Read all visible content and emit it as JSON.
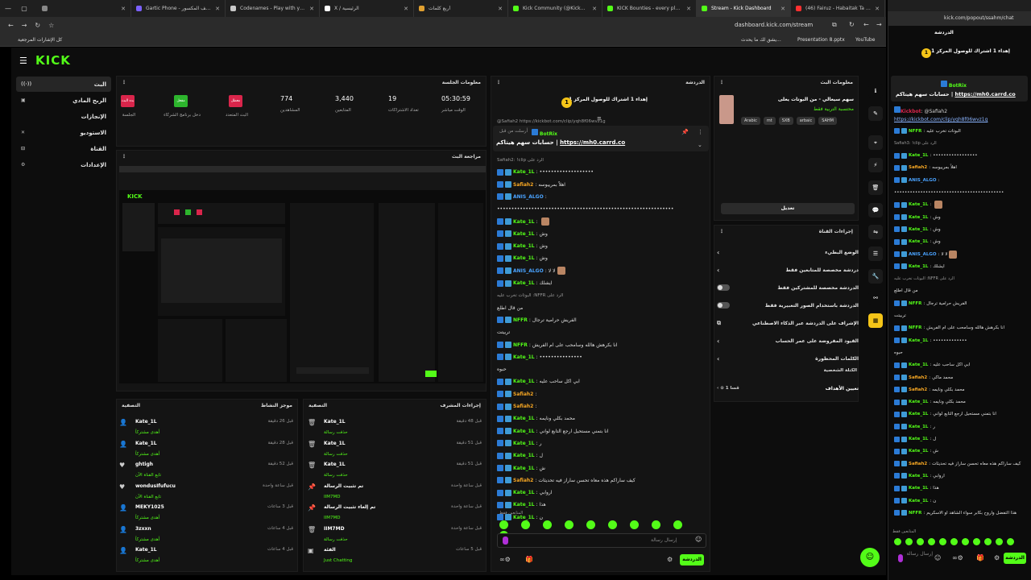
{
  "browser": {
    "tabs": [
      {
        "label": "",
        "color": "#888"
      },
      {
        "label": "Gartic Phone - الهاتف المكسور",
        "color": "#7b61ff"
      },
      {
        "label": "Codenames - Play with your Fr",
        "color": "#c9c9c9"
      },
      {
        "label": "X / الرئيسية",
        "color": "#fff"
      },
      {
        "label": "أربع كلمات",
        "color": "#e0a030"
      },
      {
        "label": "Kick Community (@KickComm",
        "color": "#53fc18"
      },
      {
        "label": "KICK Bounties - every player fo",
        "color": "#53fc18"
      },
      {
        "label": "Stream - Kick Dashboard",
        "color": "#53fc18",
        "active": true
      },
      {
        "label": "(46) Fairuz - Habaitak Ta Neseo",
        "color": "#ff3030"
      }
    ],
    "url": "dashboard.kick.com/stream",
    "bookmarks": {
      "all": "كل الإشارات المرجعية",
      "item1": "يشق لك ما يحدث...",
      "ppt": "Presentation 8.pptx",
      "yt": "YouTube"
    }
  },
  "nav": {
    "items": [
      {
        "label": "البث",
        "icon": "((·))",
        "active": true
      },
      {
        "label": "الربح المادي",
        "icon": "▣"
      },
      {
        "label": "الإنجازات",
        "icon": ""
      },
      {
        "label": "الاستوديو",
        "icon": "✕"
      },
      {
        "label": "القناة",
        "icon": "⊟"
      },
      {
        "label": "الإعدادات",
        "icon": "⚙"
      }
    ]
  },
  "session": {
    "title": "معلومات الجلسة",
    "badges": [
      {
        "label": "بدء البث",
        "sub": "الجلسة",
        "color": "#d9254b"
      },
      {
        "label": "مفعل",
        "sub": "دخل برنامج الشركاء",
        "color": "#2db52d"
      },
      {
        "label": "معطل",
        "sub": "البث المتعدد",
        "color": "#d9254b"
      }
    ],
    "stats": [
      {
        "value": "774",
        "label": "المشاهدين"
      },
      {
        "value": "3,440",
        "label": "المتابعين"
      },
      {
        "value": "19",
        "label": "تعداد الاشتراكات"
      },
      {
        "value": "05:30:59",
        "label": "الوقت مباشر"
      }
    ]
  },
  "preview": {
    "title": "مراجعة البث"
  },
  "activity": {
    "title": "موجز النشاط",
    "filter": "التصفية",
    "items": [
      {
        "name": "Kate_1L",
        "sub": "أهدى مشتركاً",
        "time": "قبل 26 دقيقة",
        "icon": "👤"
      },
      {
        "name": "Kate_1L",
        "sub": "أهدى مشتركاً",
        "time": "قبل 28 دقيقة",
        "icon": "👤"
      },
      {
        "name": "ghtigh",
        "sub": "تابع القناة الآن",
        "time": "قبل 52 دقيقة",
        "icon": "♥"
      },
      {
        "name": "wondusIfufucu",
        "sub": "تابع القناة الآن",
        "time": "قبل ساعة واحدة",
        "icon": "♥"
      },
      {
        "name": "MEKY1025",
        "sub": "أهدى مشتركاً",
        "time": "قبل 3 ساعات",
        "icon": "👤"
      },
      {
        "name": "3zxxn",
        "sub": "أهدى مشتركاً",
        "time": "قبل 4 ساعات",
        "icon": "👤"
      },
      {
        "name": "Kate_1L",
        "sub": "أهدى مشتركاً",
        "time": "قبل 4 ساعات",
        "icon": "👤"
      }
    ]
  },
  "modlog": {
    "title": "إجراءات المشرف",
    "filter": "التصفية",
    "items": [
      {
        "name": "Kate_1L",
        "sub": "حذفت رسالة",
        "time": "قبل 48 دقيقة",
        "icon": "🗑"
      },
      {
        "name": "Kate_1L",
        "sub": "حذفت رسالة",
        "time": "قبل 51 دقيقة",
        "icon": "🗑"
      },
      {
        "name": "Kate_1L",
        "sub": "حذفت رسالة",
        "time": "قبل 51 دقيقة",
        "icon": "🗑"
      },
      {
        "name": "تم تثبيت الرسالة",
        "sub": "IIM7MD",
        "time": "قبل ساعة واحدة",
        "icon": "📌"
      },
      {
        "name": "تم إلغاء تثبيت الرسالة",
        "sub": "IIM7MD",
        "time": "قبل ساعة واحدة",
        "icon": "📌"
      },
      {
        "name": "IIM7MD",
        "sub": "حذفت رسالة",
        "time": "قبل ساعة واحدة",
        "icon": "🗑"
      },
      {
        "name": "الفئة",
        "sub": "Just Chatting",
        "time": "قبل 5 ساعات",
        "icon": "▣"
      }
    ]
  },
  "chat": {
    "title": "الدردشة",
    "leaderboard": "إهداء 1 اشتراك للوصول المركز 1",
    "pinned": {
      "name": "BotRix",
      "text": "حسابات سهم هيتاكم |",
      "link": "https://mh0.carrd.co",
      "meta": "أرسلت من قبل"
    },
    "top_link": "@Safiah2 https://kickbot.com/clip/yqh8f06wvz1g",
    "messages": [
      {
        "user": "",
        "text": "الرد على Safiah2: !clip",
        "cls": "meta"
      },
      {
        "user": "Kate_1L",
        "text": "•••••••••••••••••••",
        "cls": "b"
      },
      {
        "user": "Safiah2",
        "text": "اهلاً بمرييوسه",
        "cls": "o"
      },
      {
        "user": "ANIS_ALGO",
        "text": "",
        "cls": "b"
      },
      {
        "user": "",
        "text": "••••••••••••••••••••••••••••••••••••••••••••••••••••••••••••••",
        "cls": "plain"
      },
      {
        "user": "Kate_1L",
        "text": "",
        "cls": "b",
        "avatar": true
      },
      {
        "user": "Kate_1L",
        "text": "وش",
        "cls": "b"
      },
      {
        "user": "Kate_1L",
        "text": "وش",
        "cls": "b"
      },
      {
        "user": "Kate_1L",
        "text": "وش",
        "cls": "b"
      },
      {
        "user": "ANIS_ALGO",
        "text": "لا لا",
        "cls": "b",
        "avatar": true
      },
      {
        "user": "Kate_1L",
        "text": "ايشلك",
        "cls": "b"
      },
      {
        "user": "",
        "text": "الرد على NFFR: البوتات تخرب عليه",
        "cls": "meta"
      },
      {
        "user": "",
        "text": "من قال اطلع",
        "cls": "plain"
      },
      {
        "user": "NFFR",
        "text": "الفريش حرامية ترجال",
        "cls": "g"
      },
      {
        "user": "",
        "text": "تربيتت",
        "cls": "plain"
      },
      {
        "user": "NFFR",
        "text": "انا بكرهش هالله وسامحب على ام الفريش",
        "cls": "g"
      },
      {
        "user": "Kate_1L",
        "text": "•••••••••••••••",
        "cls": "b"
      },
      {
        "user": "",
        "text": "حبوه",
        "cls": "plain"
      },
      {
        "user": "Kate_1L",
        "text": "ابي اكل ساحب عليه",
        "cls": "b"
      },
      {
        "user": "Safiah2",
        "text": "",
        "cls": "o"
      },
      {
        "user": "Safiah2",
        "text": "",
        "cls": "o"
      },
      {
        "user": "Kate_1L",
        "text": "محمد بكلي ونايمه",
        "cls": "b"
      },
      {
        "user": "Kate_1L",
        "text": "انا بتمني مستحيل ارجع التابع لواني",
        "cls": "b"
      },
      {
        "user": "Kate_1L",
        "text": "ر",
        "cls": "b"
      },
      {
        "user": "Kate_1L",
        "text": "ل",
        "cls": "b"
      },
      {
        "user": "Kate_1L",
        "text": "ش",
        "cls": "b"
      },
      {
        "user": "Safiah2",
        "text": "كيف ساراكم هذه معاه تحسن ساراز فيه تحديثات",
        "cls": "o"
      },
      {
        "user": "Kate_1L",
        "text": "اروابي",
        "cls": "b"
      },
      {
        "user": "Kate_1L",
        "text": "هذا",
        "cls": "b"
      },
      {
        "user": "Kate_1L",
        "text": "ن",
        "cls": "b"
      }
    ],
    "chat_input_placeholder": "إرسال رسالة",
    "send": "الدردشة",
    "followers_only": "المتابعين فقط"
  },
  "stream_info": {
    "title": "معلومات البث",
    "stream_title": "سهم سيعالي - من البوتات يعلى",
    "category": "محتسبة التربية فقط",
    "tags": [
      "Arabic",
      "mt",
      "SXB",
      "arbaic",
      "SAHM"
    ],
    "edit": "تعديل"
  },
  "channel_actions": {
    "title": "إجراءات القناة",
    "rows": [
      {
        "label": "الوضع البطيء",
        "ctrl": "chevron"
      },
      {
        "label": "دردشة مخصصة للمتابعين فقط",
        "ctrl": "chevron"
      },
      {
        "label": "الدردشة مخصصة للمشتركين فقط",
        "ctrl": "switch"
      },
      {
        "label": "الدردشة باستخدام الصور التعبيرية فقط",
        "ctrl": "switch"
      },
      {
        "label": "الإشراف على الدردشة عبر الذكاء الاصطناعي",
        "ctrl": "ext"
      },
      {
        "label": "القيود المفروضة على عمر الحساب",
        "ctrl": "chevron"
      },
      {
        "label": "الكلمات المحظورة",
        "ctrl": "chevron"
      }
    ],
    "goal_section": "الكتلة الشخصية",
    "goal_label": "تعيين الأهداف",
    "goal_value": "قسا 1 ⊙"
  },
  "popout": {
    "url": "kick.com/popout/ssahm/chat",
    "title": "الدردشة",
    "leaderboard": "إهداء 1 اشتراك للوصول المركز 1",
    "pinned_name": "BotRix",
    "pinned_text": "حسابات سهم هيتاكم |",
    "pinned_link": "https://mh0.carrd.co",
    "reply_user": "Kickbot",
    "reply_text": "@Safiah2",
    "reply_link": "https://kickbot.com/clip/yqh8f06wvz1g",
    "messages": [
      {
        "user": "NFFR",
        "text": "البوتات تخرب عليه",
        "cls": "g"
      },
      {
        "user": "",
        "text": "الرد على Safiah3: !clip",
        "cls": "meta"
      },
      {
        "user": "Kate_1L",
        "text": "•••••••••••••••••",
        "cls": "b"
      },
      {
        "user": "Safiah2",
        "text": "اهلاً بمرييوسه",
        "cls": "o"
      },
      {
        "user": "ANIS_ALGO",
        "text": "",
        "cls": "b"
      },
      {
        "user": "",
        "text": "••••••••••••••••••••••••••••••••••••••••••",
        "cls": "plain"
      },
      {
        "user": "Kate_1L",
        "text": "",
        "cls": "b",
        "avatar": true
      },
      {
        "user": "Kate_1L",
        "text": "وش",
        "cls": "b"
      },
      {
        "user": "Kate_1L",
        "text": "وش",
        "cls": "b"
      },
      {
        "user": "Kate_1L",
        "text": "وش",
        "cls": "b"
      },
      {
        "user": "ANIS_ALGO",
        "text": "لا لا",
        "cls": "b",
        "avatar": true
      },
      {
        "user": "Kate_1L",
        "text": "ايشلك",
        "cls": "b"
      },
      {
        "user": "",
        "text": "الرد على NFFR: البوتات تخرب عليه",
        "cls": "meta"
      },
      {
        "user": "",
        "text": "من قال اطلع",
        "cls": "plain"
      },
      {
        "user": "NFFR",
        "text": "الفريش حرامية ترجال",
        "cls": "g"
      },
      {
        "user": "",
        "text": "تربيتت",
        "cls": "plain"
      },
      {
        "user": "NFFR",
        "text": "انا بكرهش هالله وسامحب على ام الفريش",
        "cls": "g"
      },
      {
        "user": "Kate_1L",
        "text": "•••••••••••••",
        "cls": "b"
      },
      {
        "user": "",
        "text": "حبوه",
        "cls": "plain"
      },
      {
        "user": "Kate_1L",
        "text": "ابي اكل ساحب عليه",
        "cls": "b"
      },
      {
        "user": "Safiah2",
        "text": "محمد ماكي",
        "cls": "o"
      },
      {
        "user": "Safiah2",
        "text": "محمد بكلي ونايمه",
        "cls": "o"
      },
      {
        "user": "Kate_1L",
        "text": "محمد بكلي ونايمه",
        "cls": "b"
      },
      {
        "user": "Kate_1L",
        "text": "انا بتمني مستحيل ارجع التابع لواني",
        "cls": "b"
      },
      {
        "user": "Kate_1L",
        "text": "ر",
        "cls": "b"
      },
      {
        "user": "Kate_1L",
        "text": "ل",
        "cls": "b"
      },
      {
        "user": "Kate_1L",
        "text": "ش",
        "cls": "b"
      },
      {
        "user": "Safiah2",
        "text": "كيف ساراكم هذه معاه تحسن ساراز فيه تحديثات",
        "cls": "o"
      },
      {
        "user": "Kate_1L",
        "text": "اروابي",
        "cls": "b"
      },
      {
        "user": "Kate_1L",
        "text": "هذا",
        "cls": "b"
      },
      {
        "user": "Kate_1L",
        "text": "ن",
        "cls": "b"
      },
      {
        "user": "NFFR",
        "text": "هذا التفضل واروح بكابر سواء الشاهد او الاسكريم",
        "cls": "g"
      }
    ],
    "input_placeholder": "إرسال رسالة",
    "send": "الدردشة",
    "followers_only": "المتابعين فقط"
  },
  "colors": {
    "brand": "#53fc18",
    "bg": "#0d0d0d",
    "panel": "#141414"
  }
}
